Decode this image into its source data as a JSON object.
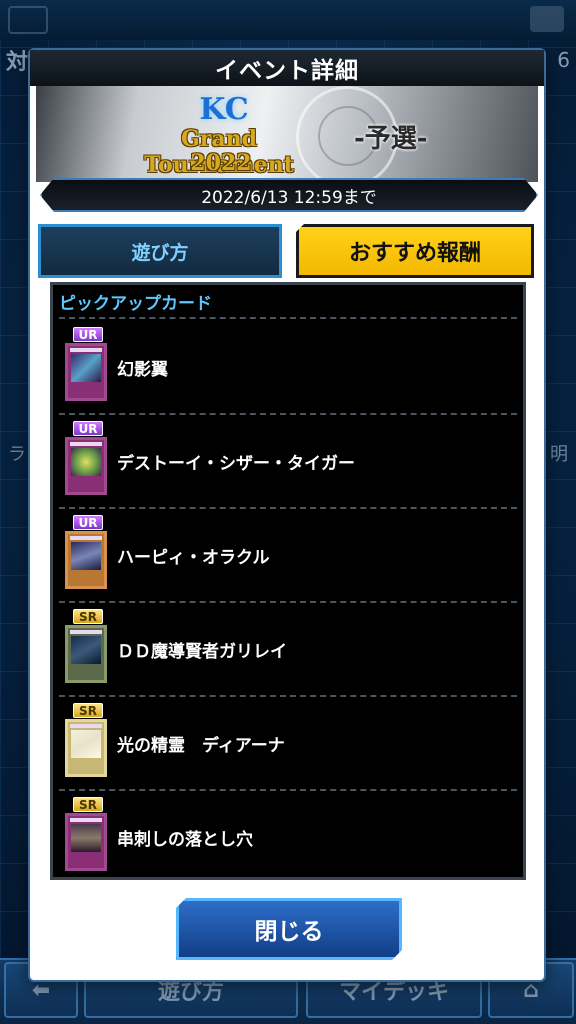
{
  "background": {
    "left_label": "対戦",
    "right_label": "6",
    "side_left": "ラ",
    "side_right": "明",
    "nav": {
      "howto_label": "遊び方",
      "deck_label": "マイデッキ"
    }
  },
  "modal": {
    "title": "イベント詳細",
    "banner": {
      "logo_text": "KC",
      "event_name": "Grand Tournament",
      "event_year": "2022",
      "stage": "-予選-"
    },
    "deadline": "2022/6/13 12:59まで",
    "tabs": {
      "howto": "遊び方",
      "rewards": "おすすめ報酬"
    },
    "pickup": {
      "heading": "ピックアップカード",
      "cards": [
        {
          "rarity": "UR",
          "name": "幻影翼"
        },
        {
          "rarity": "UR",
          "name": "デストーイ・シザー・タイガー"
        },
        {
          "rarity": "UR",
          "name": "ハーピィ・オラクル"
        },
        {
          "rarity": "SR",
          "name": "ＤＤ魔導賢者ガリレイ"
        },
        {
          "rarity": "SR",
          "name": "光の精霊　ディアーナ"
        },
        {
          "rarity": "SR",
          "name": "串刺しの落とし穴"
        }
      ]
    },
    "close_label": "閉じる"
  },
  "colors": {
    "accent_gold": "#f3b800",
    "accent_blue": "#2e8fd0",
    "heading_cyan": "#5cc8ff",
    "rarity_ur": "#a552e6",
    "rarity_sr": "#e8c24a"
  }
}
